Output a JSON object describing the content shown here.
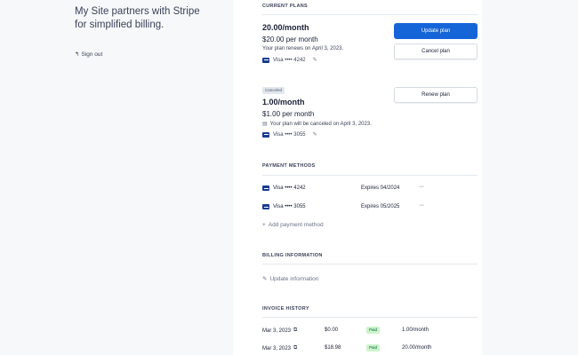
{
  "sidebar": {
    "tagline": "My Site partners with Stripe for simplified billing.",
    "signout_label": "Sign out"
  },
  "current_plans": {
    "title": "CURRENT PLANS",
    "plans": [
      {
        "name": "20.00/month",
        "price": "$20.00 per month",
        "note": "Your plan renews on April 3, 2023.",
        "card": "Visa •••• 4242",
        "actions": [
          "Update plan",
          "Cancel plan"
        ]
      },
      {
        "badge": "Canceled",
        "name": "1.00/month",
        "price": "$1.00 per month",
        "note": "Your plan will be canceled on April 3, 2023.",
        "card": "Visa •••• 3055",
        "actions": [
          "Renew plan"
        ]
      }
    ]
  },
  "payment_methods": {
    "title": "PAYMENT METHODS",
    "items": [
      {
        "card": "Visa •••• 4242",
        "expires": "Expires 04/2024",
        "more": "···"
      },
      {
        "card": "Visa •••• 3055",
        "expires": "Expires 05/2025",
        "more": "···"
      }
    ],
    "add_label": "Add payment method"
  },
  "billing_information": {
    "title": "BILLING INFORMATION",
    "update_label": "Update information"
  },
  "invoice_history": {
    "title": "INVOICE HISTORY",
    "rows": [
      {
        "date": "Mar 3, 2023",
        "amount": "$0.00",
        "status": "Paid",
        "description": "1.00/month"
      },
      {
        "date": "Mar 3, 2023",
        "amount": "$18.98",
        "status": "Paid",
        "description": "20.00/month"
      }
    ]
  },
  "colors": {
    "primary": "#1565d8",
    "sidebar_bg": "#f6f8fa",
    "paid_bg": "#cbf4c9",
    "paid_text": "#0e6245"
  }
}
